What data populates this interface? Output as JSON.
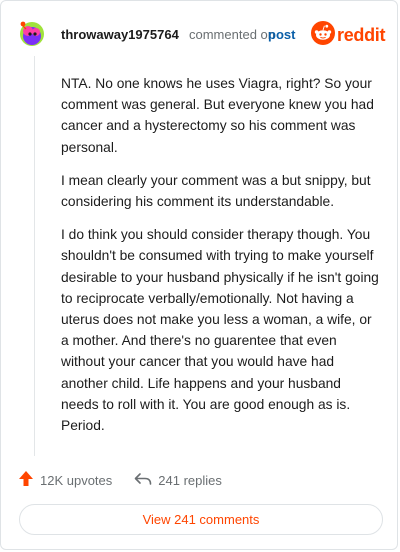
{
  "comment": {
    "username": "throwaway1975764",
    "action_text": "commented on",
    "post_link": "post",
    "brand": "reddit",
    "paragraphs": [
      "NTA. No one knows he uses Viagra, right? So your comment was general. But everyone knew you had cancer and a hysterectomy so his comment was personal.",
      "I mean clearly your comment was a but snippy, but considering his comment its understandable.",
      "I do think you should consider therapy though. You shouldn't be consumed with trying to make yourself desirable to your husband physically if he isn't going to reciprocate verbally/emotionally. Not having a uterus does not make you less a woman, a wife, or a mother. And there's no guarentee that even without your cancer that you would have had another child. Life happens and your husband needs to roll with it. You are good enough as is. Period."
    ]
  },
  "stats": {
    "upvotes": "12K upvotes",
    "replies": "241 replies"
  },
  "footer": {
    "view_comments": "View 241 comments"
  },
  "colors": {
    "accent": "#ff4500",
    "link": "#0a5fa8",
    "muted": "#6a6f72"
  }
}
